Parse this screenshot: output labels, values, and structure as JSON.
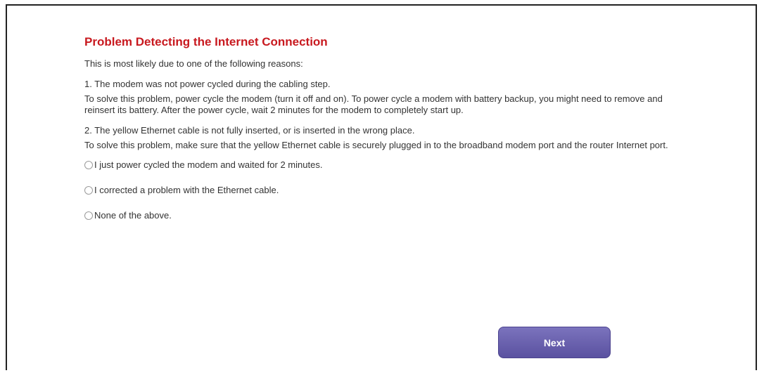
{
  "page": {
    "title": "Problem Detecting the Internet Connection",
    "intro": "This is most likely due to one of the following reasons:"
  },
  "reasons": [
    {
      "heading": "1.  The modem was not power cycled during the cabling step.",
      "body": "To solve this problem, power cycle the modem (turn it off and on). To power cycle a modem with battery backup, you might need to remove and reinsert its battery. After the power cycle, wait 2 minutes for the modem to completely start up."
    },
    {
      "heading": "2.  The yellow Ethernet cable is not fully inserted, or is inserted in the wrong place.",
      "body": "To solve this problem, make sure that the yellow Ethernet cable is securely plugged in to the broadband modem port and the router Internet port."
    }
  ],
  "options": [
    {
      "label": "I just power cycled the modem and waited for 2 minutes.",
      "selected": false
    },
    {
      "label": "I corrected a problem with the Ethernet cable.",
      "selected": false
    },
    {
      "label": "None of the above.",
      "selected": false
    }
  ],
  "buttons": {
    "next_label": "Next"
  },
  "colors": {
    "title": "#c8191f",
    "button": "#6b63b0",
    "text": "#333333"
  }
}
